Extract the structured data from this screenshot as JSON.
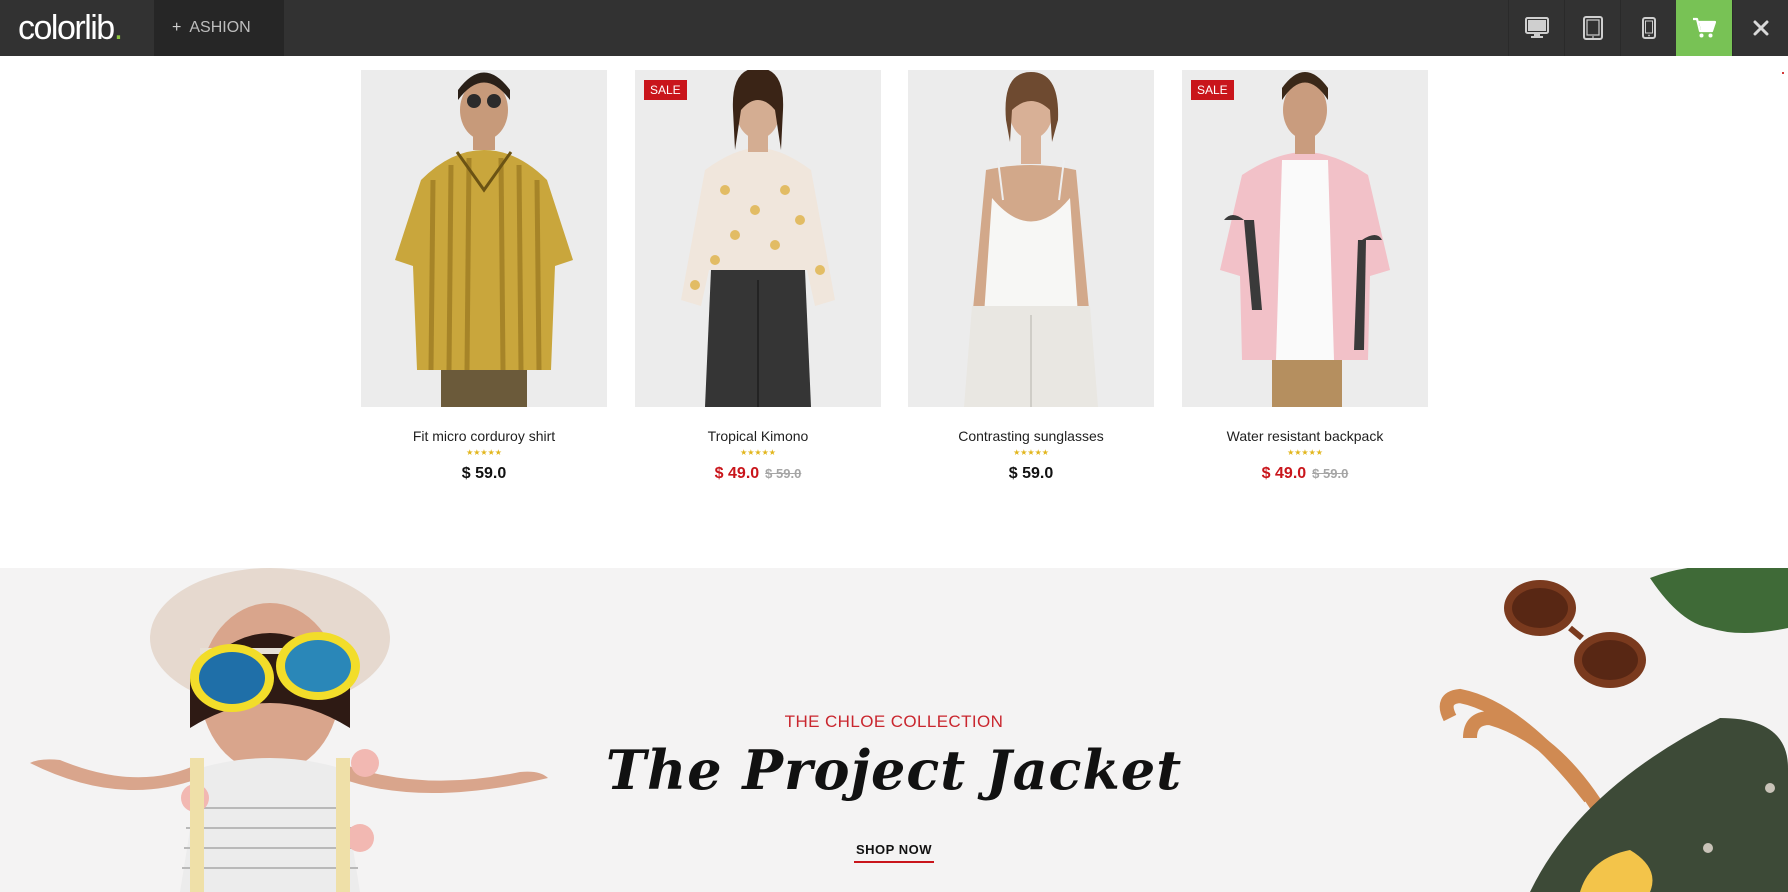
{
  "topbar": {
    "logo_text": "colorlib",
    "logo_dot": ".",
    "theme_plus": "+",
    "theme_name": "ASHION",
    "buttons": [
      "desktop-icon",
      "tablet-icon",
      "mobile-icon",
      "cart-icon",
      "close-icon"
    ],
    "cart_color": "#78c255"
  },
  "products": [
    {
      "name": "Fit micro corduroy shirt",
      "stars": "★★★★★",
      "price": "$ 59.0",
      "old_price": "",
      "sale": false
    },
    {
      "name": "Tropical Kimono",
      "stars": "★★★★★",
      "price": "$ 49.0",
      "old_price": "$ 59.0",
      "sale": true,
      "badge": "SALE"
    },
    {
      "name": "Contrasting sunglasses",
      "stars": "★★★★★",
      "price": "$ 59.0",
      "old_price": "",
      "sale": false
    },
    {
      "name": "Water resistant backpack",
      "stars": "★★★★★",
      "price": "$ 49.0",
      "old_price": "$ 59.0",
      "sale": true,
      "badge": "SALE"
    }
  ],
  "banner": {
    "kicker": "THE CHLOE COLLECTION",
    "title": "The Project Jacket",
    "cta": "SHOP NOW"
  },
  "colors": {
    "accent_red": "#c9151b",
    "star_gold": "#e2b61d",
    "topbar_bg": "#323232"
  }
}
